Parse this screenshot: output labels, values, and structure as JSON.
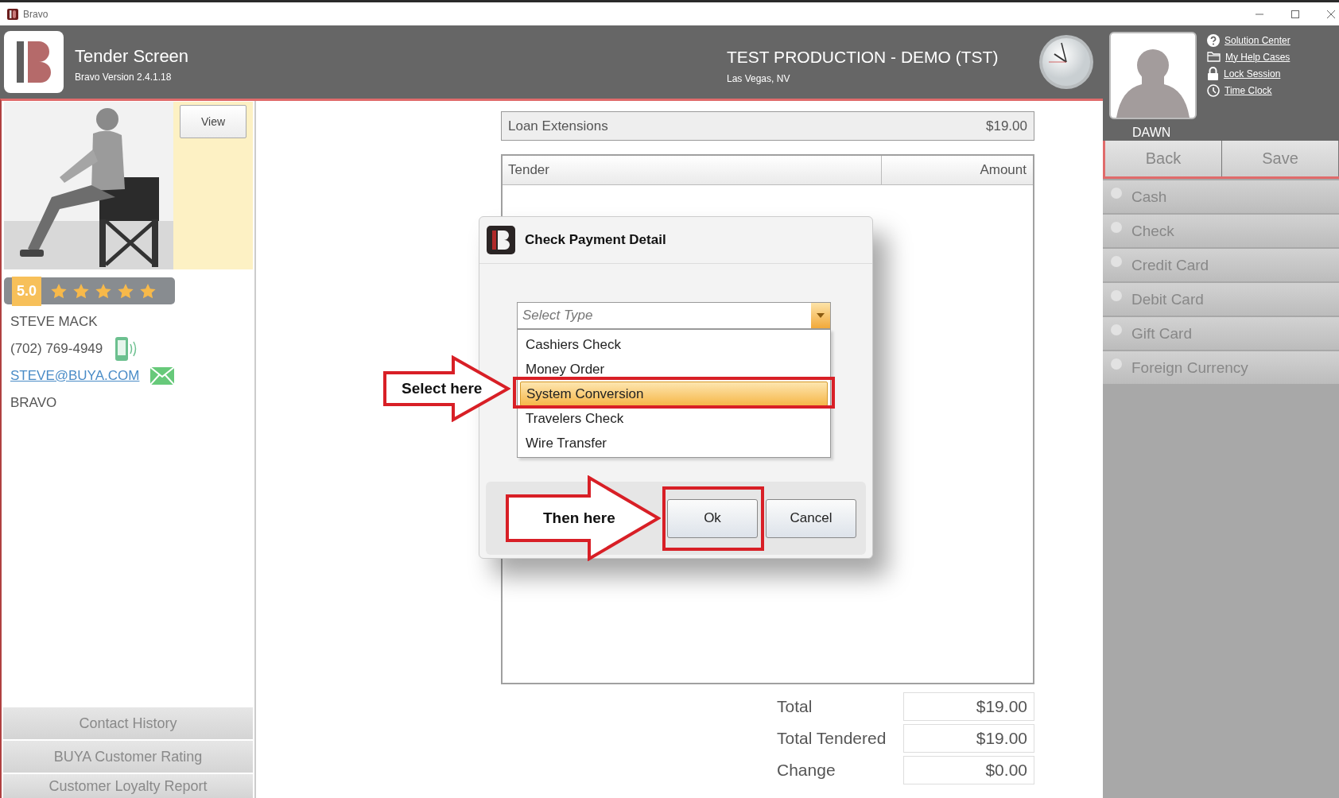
{
  "window": {
    "title": "Bravo"
  },
  "header": {
    "title": "Tender Screen",
    "version": "Bravo Version 2.4.1.18",
    "store": "TEST PRODUCTION - DEMO (TST)",
    "location": "Las Vegas, NV"
  },
  "user": {
    "name": "DAWN",
    "links": [
      {
        "label": "Solution Center",
        "kind": "help"
      },
      {
        "label": "My Help Cases",
        "kind": "folder"
      },
      {
        "label": "Lock Session",
        "kind": "lock"
      },
      {
        "label": "Time Clock",
        "kind": "clock"
      }
    ]
  },
  "actions": [
    "Back",
    "Save"
  ],
  "tender_types": [
    {
      "label": "Cash",
      "selected": false
    },
    {
      "label": "Check",
      "selected": false
    },
    {
      "label": "Credit Card",
      "selected": false
    },
    {
      "label": "Debit Card",
      "selected": false
    },
    {
      "label": "Gift Card",
      "selected": false
    },
    {
      "label": "Foreign Currency",
      "selected": false
    }
  ],
  "customer": {
    "view_button": "View",
    "rating": "5.0",
    "stars": 5,
    "name": "STEVE MACK",
    "phone": "(702) 769-4949",
    "email": "STEVE@BUYA.COM",
    "company": "BRAVO"
  },
  "reports": [
    "Contact History",
    "BUYA Customer Rating",
    "Customer Loyalty Report"
  ],
  "summary": {
    "label": "Loan Extensions",
    "amount": "$19.00"
  },
  "tender_table": {
    "columns": [
      "Tender",
      "Amount"
    ]
  },
  "totals": [
    {
      "label": "Total",
      "value": "$19.00"
    },
    {
      "label": "Total Tendered",
      "value": "$19.00"
    },
    {
      "label": "Change",
      "value": "$0.00"
    }
  ],
  "dialog": {
    "title": "Check Payment Detail",
    "select": {
      "placeholder": "Select Type",
      "expanded": true,
      "options": [
        {
          "label": "Cashiers Check",
          "selected": false
        },
        {
          "label": "Money Order",
          "selected": false
        },
        {
          "label": "System Conversion",
          "selected": true
        },
        {
          "label": "Travelers Check",
          "selected": false
        },
        {
          "label": "Wire Transfer",
          "selected": false
        }
      ]
    },
    "buttons": [
      "Ok",
      "Cancel"
    ]
  },
  "annotations": [
    {
      "label": "Select here"
    },
    {
      "label": "Then here"
    }
  ]
}
